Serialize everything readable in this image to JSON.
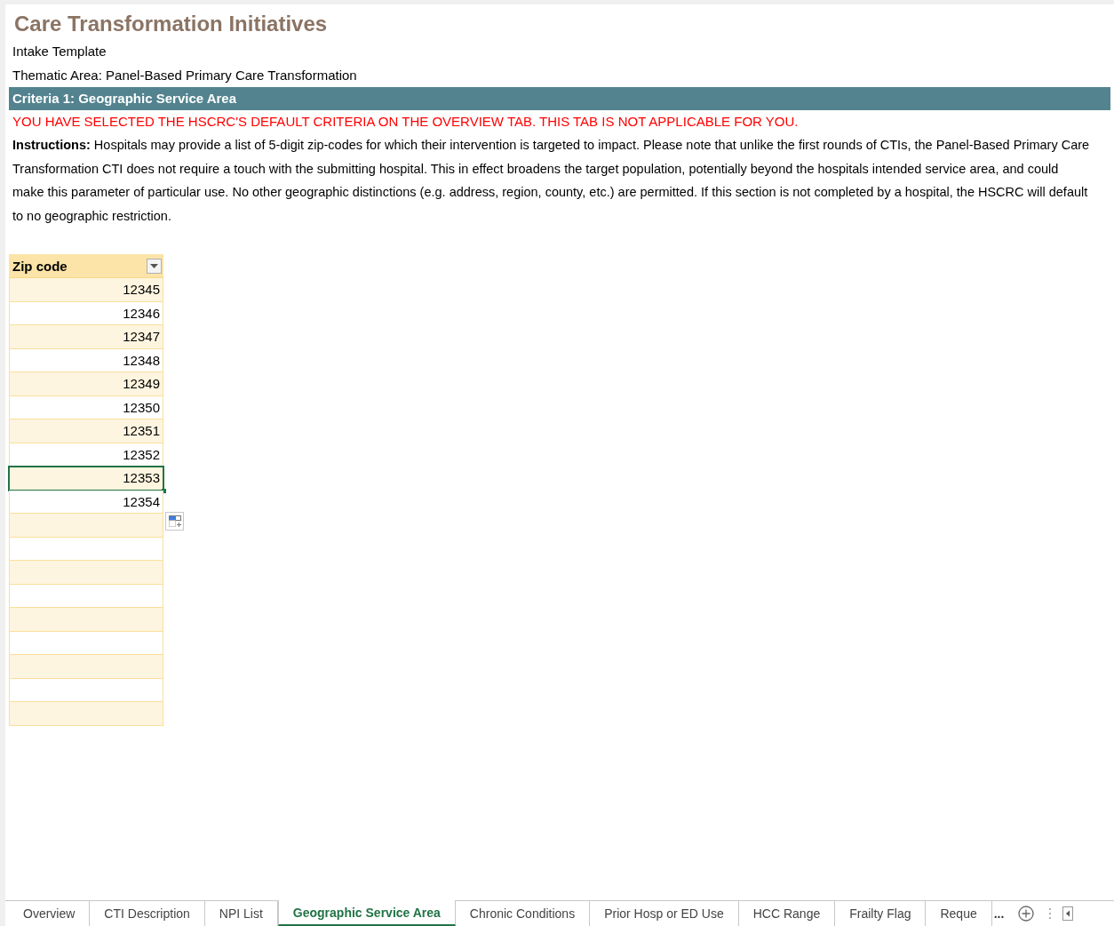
{
  "title": "Care Transformation Initiatives",
  "subtitle": "Intake Template",
  "thematic_area": "Thematic Area: Panel-Based Primary Care Transformation",
  "section_header": "Criteria 1: Geographic Service Area",
  "warning": "YOU HAVE SELECTED THE HSCRC'S DEFAULT CRITERIA ON THE OVERVIEW TAB. THIS TAB IS NOT APPLICABLE FOR YOU.",
  "instructions": "**Instructions:** Hospitals may provide a list of 5-digit zip-codes for which their intervention is targeted to impact. Please note that unlike the first rounds of CTIs, the Panel-Based Primary Care Transformation CTI does not require a touch with the submitting hospital. This in effect broadens the target population, potentially beyond the hospitals intended service area, and could make this parameter of particular use. No other geographic distinctions (e.g. address, region, county, etc.) are permitted. If this section is not completed by a hospital, the HSCRC will default to no geographic restriction.",
  "table": {
    "header": "Zip code",
    "rows": [
      {
        "zip": "12345",
        "selected": false
      },
      {
        "zip": "12346",
        "selected": false
      },
      {
        "zip": "12347",
        "selected": false
      },
      {
        "zip": "12348",
        "selected": false
      },
      {
        "zip": "12349",
        "selected": false
      },
      {
        "zip": "12350",
        "selected": false
      },
      {
        "zip": "12351",
        "selected": false
      },
      {
        "zip": "12352",
        "selected": false
      },
      {
        "zip": "12353",
        "selected": true
      },
      {
        "zip": "12354",
        "selected": false
      },
      {
        "selected": false
      },
      {
        "selected": false
      },
      {
        "selected": false
      },
      {
        "selected": false
      },
      {
        "selected": false
      },
      {
        "selected": false
      },
      {
        "selected": false
      },
      {
        "selected": false
      },
      {
        "selected": false
      }
    ]
  },
  "sheet_tabs": [
    {
      "label": "Overview",
      "selected": false
    },
    {
      "label": "CTI Description",
      "selected": false
    },
    {
      "label": "NPI List",
      "selected": false
    },
    {
      "label": "Geographic Service Area",
      "selected": true
    },
    {
      "label": "Chronic Conditions",
      "selected": false
    },
    {
      "label": "Prior Hosp or ED Use",
      "selected": false
    },
    {
      "label": "HCC Range",
      "selected": false
    },
    {
      "label": "Frailty Flag",
      "selected": false
    },
    {
      "label": "Reque",
      "selected": false
    }
  ],
  "more_tabs": "..."
}
